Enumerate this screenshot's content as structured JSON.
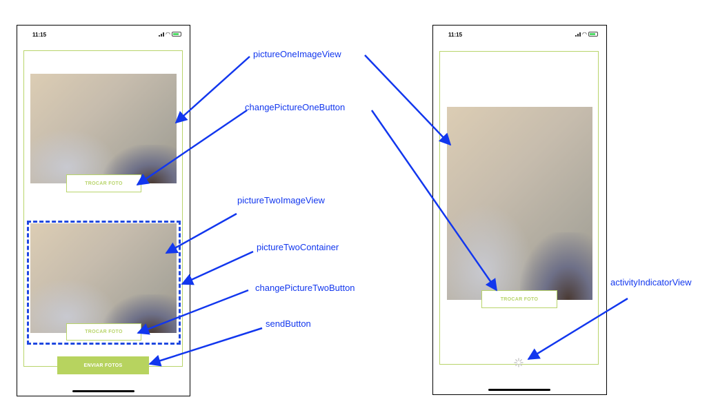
{
  "status_bar": {
    "time": "11:15"
  },
  "left_screen": {
    "change_picture_one_label": "TROCAR FOTO",
    "change_picture_two_label": "TROCAR FOTO",
    "send_label": "ENVIAR FOTOS"
  },
  "right_screen": {
    "change_picture_label": "TROCAR FOTO"
  },
  "annotations": {
    "picture_one_image_view": "pictureOneImageView",
    "change_picture_one_button": "changePictureOneButton",
    "picture_two_image_view": "pictureTwoImageView",
    "picture_two_container": "pictureTwoContainer",
    "change_picture_two_button": "changePictureTwoButton",
    "send_button": "sendButton",
    "activity_indicator_view": "activityIndicatorView"
  },
  "colors": {
    "accent_green": "#b8d46a",
    "annotation_blue": "#1237ee",
    "dashed_outline": "#1f48e0"
  }
}
